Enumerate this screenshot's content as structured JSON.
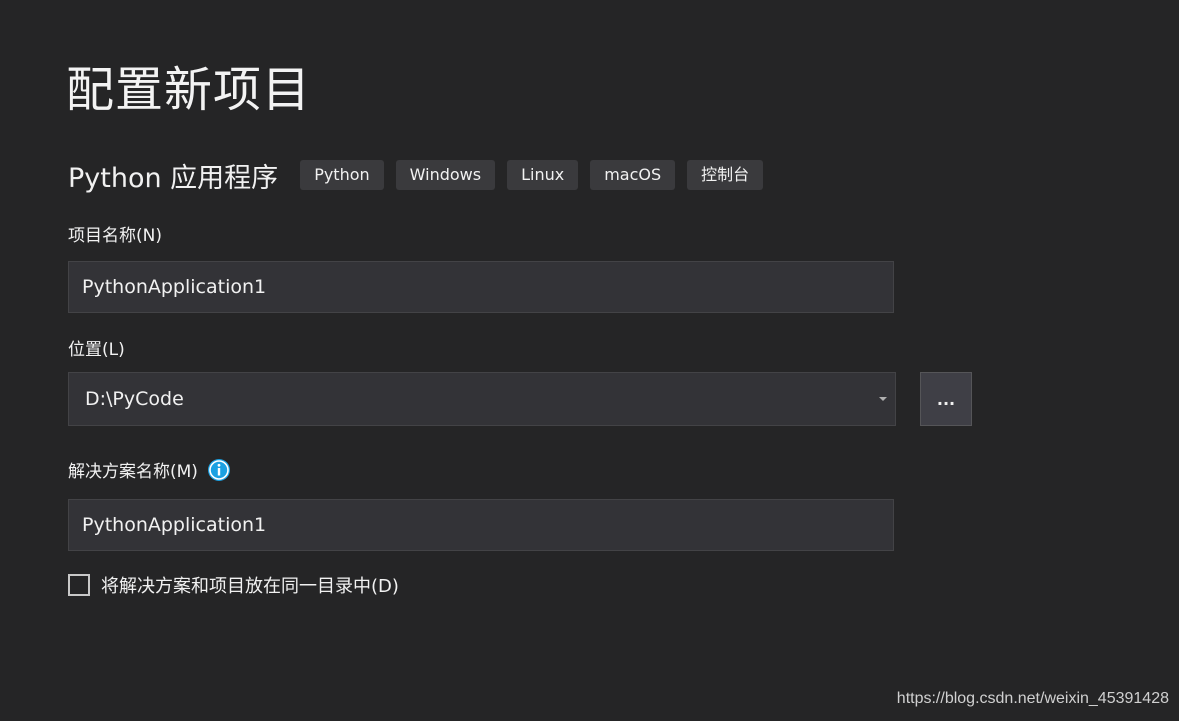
{
  "page": {
    "title": "配置新项目"
  },
  "template": {
    "name": "Python 应用程序",
    "tags": [
      "Python",
      "Windows",
      "Linux",
      "macOS",
      "控制台"
    ]
  },
  "project_name": {
    "label": "项目名称(N)",
    "value": "PythonApplication1"
  },
  "location": {
    "label": "位置(L)",
    "value": "D:\\PyCode",
    "browse_label": "..."
  },
  "solution_name": {
    "label": "解决方案名称(M)",
    "value": "PythonApplication1",
    "info_icon": "info-icon"
  },
  "same_directory": {
    "label": "将解决方案和项目放在同一目录中(D)",
    "checked": false
  },
  "watermark": "https://blog.csdn.net/weixin_45391428",
  "colors": {
    "background": "#252526",
    "input_background": "#333337",
    "input_border": "#434346",
    "tag_background": "#3a3a3d",
    "info_accent": "#1ba1e2",
    "text": "#f1f1f1"
  }
}
